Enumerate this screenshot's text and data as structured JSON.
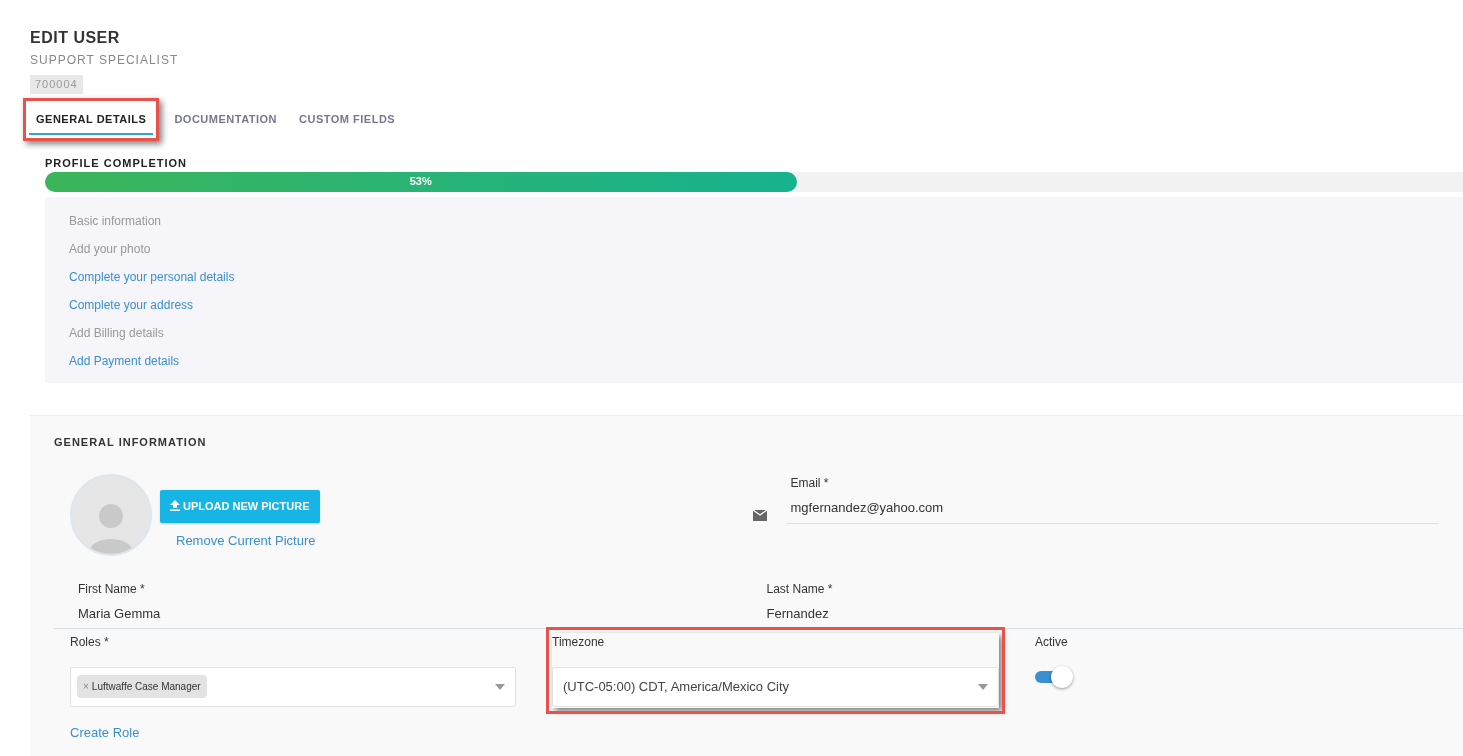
{
  "header": {
    "title": "EDIT USER",
    "subtitle": "SUPPORT SPECIALIST",
    "id_badge": "700004"
  },
  "tabs": [
    {
      "label": "GENERAL DETAILS",
      "selected": true,
      "highlighted": true
    },
    {
      "label": "DOCUMENTATION",
      "selected": false,
      "highlighted": false
    },
    {
      "label": "CUSTOM FIELDS",
      "selected": false,
      "highlighted": false
    }
  ],
  "profile_completion": {
    "title": "PROFILE COMPLETION",
    "level": 0.53,
    "reading": "53%",
    "steps": [
      {
        "label": "Basic information",
        "done": true
      },
      {
        "label": "Add your photo",
        "done": true
      },
      {
        "label": "Complete your personal details",
        "done": false
      },
      {
        "label": "Complete your address",
        "done": false
      },
      {
        "label": "Add Billing details",
        "done": true
      },
      {
        "label": "Add Payment details",
        "done": false
      }
    ]
  },
  "general_information": {
    "title": "GENERAL INFORMATION",
    "upload_button": "UPLOAD NEW PICTURE",
    "remove_link": "Remove Current Picture",
    "email": {
      "label": "Email *",
      "value": "mgfernandez@yahoo.com"
    },
    "first_name": {
      "label": "First Name *",
      "value": "Maria Gemma"
    },
    "last_name": {
      "label": "Last Name *",
      "value": "Fernandez"
    },
    "roles": {
      "label": "Roles *",
      "tags": [
        "Luftwaffe Case Manager"
      ],
      "tag_remove": "×"
    },
    "create_role_link": "Create Role",
    "timezone": {
      "label": "Timezone",
      "value": "(UTC-05:00) CDT, America/Mexico City",
      "highlighted": true
    },
    "active": {
      "label": "Active",
      "on": true
    }
  }
}
